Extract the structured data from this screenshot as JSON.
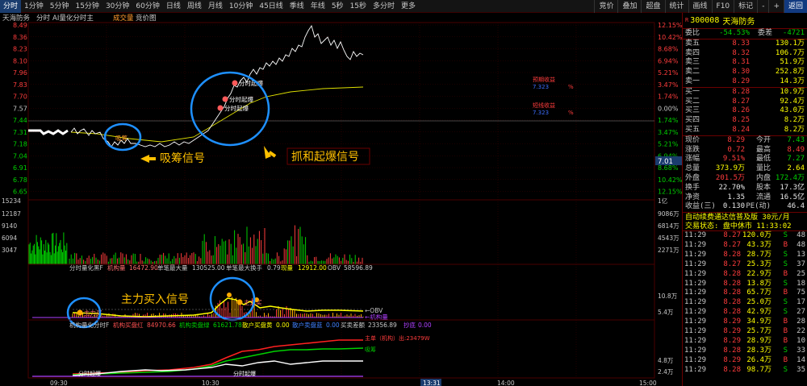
{
  "toolbar": {
    "tabs": [
      "分时",
      "1分钟",
      "5分钟",
      "15分钟",
      "30分钟",
      "60分钟",
      "日线",
      "周线",
      "月线",
      "10分钟",
      "45日线",
      "季线",
      "年线",
      "5秒",
      "15秒",
      "多分时",
      "更多"
    ],
    "tools": [
      "竞价",
      "叠加",
      "超盘",
      "统计",
      "画线",
      "F10",
      "标记",
      "-",
      "+",
      "返回"
    ]
  },
  "chart": {
    "header_labels": [
      "天海防务",
      "分时",
      "AI量化分时主",
      "成交量",
      "竞价图"
    ],
    "price_labels": [
      "8.49",
      "8.36",
      "8.23",
      "8.10",
      "7.96",
      "7.83",
      "7.70",
      "7.57",
      "7.44",
      "7.31",
      "7.18",
      "7.04",
      "6.91",
      "6.78",
      "6.65"
    ],
    "pct_labels": [
      "12.15%",
      "10.42%",
      "8.68%",
      "6.94%",
      "5.21%",
      "3.47%",
      "1.74%",
      "0.00%",
      "1.74%",
      "3.47%",
      "5.21%",
      "6.94%",
      "8.68%",
      "10.42%",
      "12.15%"
    ],
    "current_price_tag": "7.01",
    "vol_left_labels": [
      "15234",
      "12187",
      "9140",
      "6094",
      "3047"
    ],
    "vol_right_labels": [
      "1亿",
      "9086万",
      "6814万",
      "4543万",
      "2271万"
    ],
    "indicator1": {
      "name": "分时量化黑F",
      "label1": "机构量",
      "val1": "16472.90",
      "label2": "单笔最大量",
      "val2": "130525.00",
      "label3": "单笔最大换手",
      "val3": "0.79",
      "label4": "现量",
      "val4": "12912.00",
      "label5": "OBV",
      "val5": "58596.89",
      "right_labels": [
        "10.8万",
        "5.4万"
      ],
      "legend": [
        "←OBV",
        "←机构量"
      ]
    },
    "indicator2": {
      "name": "机构量化分时F",
      "label1": "机构买盘红",
      "val1": "84970.66",
      "label2": "机构卖盘绿",
      "val2": "61621.78",
      "label3": "散户买盘黄",
      "val3": "0.00",
      "label4": "散户卖盘蓝",
      "val4": "0.00",
      "label5": "买卖差额",
      "val5": "23356.89",
      "label6": "抄底",
      "val6": "0.00",
      "right_labels": [
        "4.8万",
        "2.4万"
      ],
      "legend": [
        "主单（机构）出:23479W",
        "吸筹"
      ]
    },
    "time_labels": [
      "09:30",
      "10:30",
      "13:31",
      "14:00",
      "15:00"
    ],
    "annotations": {
      "absorb_signal": "吸筹信号",
      "capture_signal": "抓和起爆信号",
      "main_buy_signal": "主力买入信号",
      "marker_absorb": "吸筹",
      "marker_start1": "分时起爆",
      "marker_start2": "分时起爆",
      "marker_start3": "分时起爆",
      "marker_main": "主力买",
      "marker_main2": "主力买",
      "marker_bottom1": "分时起爆",
      "marker_bottom2": "分时起爆",
      "marker_profit1": "预期收益",
      "marker_profit2": "短线收益",
      "profit_val1": "7.323",
      "profit_val2": "7.323"
    }
  },
  "quote": {
    "badge": "R",
    "code": "300008",
    "name": "天海防务",
    "weibi_label": "委比",
    "weibi": "-54.53%",
    "weicha_label": "委差",
    "weicha": "-4721",
    "asks": [
      {
        "label": "卖五",
        "price": "8.33",
        "vol": "130.1万"
      },
      {
        "label": "卖四",
        "price": "8.32",
        "vol": "106.7万"
      },
      {
        "label": "卖三",
        "price": "8.31",
        "vol": "51.9万"
      },
      {
        "label": "卖二",
        "price": "8.30",
        "vol": "252.8万"
      },
      {
        "label": "卖一",
        "price": "8.29",
        "vol": "14.3万"
      }
    ],
    "bids": [
      {
        "label": "买一",
        "price": "8.28",
        "vol": "10.9万"
      },
      {
        "label": "买二",
        "price": "8.27",
        "vol": "92.4万"
      },
      {
        "label": "买三",
        "price": "8.26",
        "vol": "43.0万"
      },
      {
        "label": "买四",
        "price": "8.25",
        "vol": "8.2万"
      },
      {
        "label": "买五",
        "price": "8.24",
        "vol": "8.2万"
      }
    ],
    "stats": [
      {
        "l1": "现价",
        "v1": "8.29",
        "l2": "今开",
        "v2": "7.43"
      },
      {
        "l1": "涨跌",
        "v1": "0.72",
        "l2": "最高",
        "v2": "8.49"
      },
      {
        "l1": "涨幅",
        "v1": "9.51%",
        "l2": "最低",
        "v2": "7.27"
      },
      {
        "l1": "总量",
        "v1": "373.9万",
        "l2": "量比",
        "v2": "2.64"
      },
      {
        "l1": "外盘",
        "v1": "201.5万",
        "l2": "内盘",
        "v2": "172.4万"
      },
      {
        "l1": "换手",
        "v1": "22.70%",
        "l2": "股本",
        "v2": "17.3亿"
      },
      {
        "l1": "净资",
        "v1": "1.35",
        "l2": "流通",
        "v2": "16.5亿"
      },
      {
        "l1": "收益(三)",
        "v1": "0.130",
        "l2": "PE(动)",
        "v2": "46.4"
      }
    ],
    "promo": "自动续费通达信普及版 30元/月",
    "status": "交易状态: 盘中休市 11:33:02",
    "ticks": [
      {
        "t": "11:29",
        "p": "8.27",
        "v": "120.0万",
        "bs": "S",
        "n": "48"
      },
      {
        "t": "11:29",
        "p": "8.27",
        "v": "43.3万",
        "bs": "B",
        "n": "48"
      },
      {
        "t": "11:29",
        "p": "8.28",
        "v": "28.7万",
        "bs": "S",
        "n": "13"
      },
      {
        "t": "11:29",
        "p": "8.27",
        "v": "25.3万",
        "bs": "S",
        "n": "37"
      },
      {
        "t": "11:29",
        "p": "8.28",
        "v": "22.9万",
        "bs": "B",
        "n": "25"
      },
      {
        "t": "11:29",
        "p": "8.28",
        "v": "13.8万",
        "bs": "S",
        "n": "18"
      },
      {
        "t": "11:29",
        "p": "8.28",
        "v": "65.7万",
        "bs": "B",
        "n": "75"
      },
      {
        "t": "11:29",
        "p": "8.28",
        "v": "25.0万",
        "bs": "S",
        "n": "17"
      },
      {
        "t": "11:29",
        "p": "8.28",
        "v": "42.9万",
        "bs": "S",
        "n": "27"
      },
      {
        "t": "11:29",
        "p": "8.29",
        "v": "34.9万",
        "bs": "B",
        "n": "28"
      },
      {
        "t": "11:29",
        "p": "8.29",
        "v": "25.7万",
        "bs": "B",
        "n": "22"
      },
      {
        "t": "11:29",
        "p": "8.29",
        "v": "28.9万",
        "bs": "B",
        "n": "10"
      },
      {
        "t": "11:29",
        "p": "8.28",
        "v": "28.3万",
        "bs": "S",
        "n": "33"
      },
      {
        "t": "11:29",
        "p": "8.29",
        "v": "26.4万",
        "bs": "B",
        "n": "14"
      },
      {
        "t": "11:29",
        "p": "8.28",
        "v": "98.7万",
        "bs": "S",
        "n": "35"
      }
    ]
  },
  "colors": {
    "bg": "#000000",
    "up": "#ff3c3c",
    "down": "#00d000",
    "avg": "#e0e000",
    "accent_blue": "#1e90ff",
    "annot_yellow": "#ffc000"
  }
}
